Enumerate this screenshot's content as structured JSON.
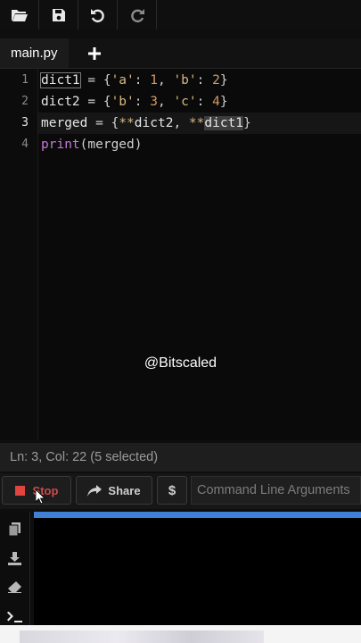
{
  "toolbar": {
    "icons": [
      "open-folder-icon",
      "save-icon",
      "undo-icon",
      "redo-icon"
    ]
  },
  "tabs": [
    {
      "label": "main.py",
      "active": true
    }
  ],
  "editor": {
    "line_numbers": [
      "1",
      "2",
      "3",
      "4"
    ],
    "active_line": 3,
    "lines": [
      "dict1 = {'a': 1, 'b': 2}",
      "dict2 = {'b': 3, 'c': 4}",
      "merged = {**dict2, **dict1}",
      "print(merged)"
    ],
    "tokens": {
      "l1": [
        "dict1",
        " = {",
        "'a'",
        ": ",
        "1",
        ", ",
        "'b'",
        ": ",
        "2",
        "}"
      ],
      "l2": [
        "dict2",
        " = {",
        "'b'",
        ": ",
        "3",
        ", ",
        "'c'",
        ": ",
        "4",
        "}"
      ],
      "l3": [
        "merged",
        " = {",
        "**",
        "dict2",
        ", ",
        "**",
        "dict1",
        "}"
      ],
      "l4": [
        "print",
        "(merged)"
      ]
    }
  },
  "watermark": "@Bitscaled",
  "status": {
    "text": "Ln: 3,  Col: 22 (5 selected)"
  },
  "run_toolbar": {
    "stop_label": "Stop",
    "share_label": "Share",
    "dollar_label": "$",
    "args_placeholder": "Command Line Arguments"
  },
  "output_panel": {
    "side_icons": [
      "copy-icon",
      "download-icon",
      "eraser-icon",
      "terminal-icon"
    ]
  },
  "colors": {
    "stop": "#c94b4b",
    "progress": "#3f7fd6",
    "string": "#d7b880",
    "number": "#d19a66",
    "function": "#c678dd"
  }
}
